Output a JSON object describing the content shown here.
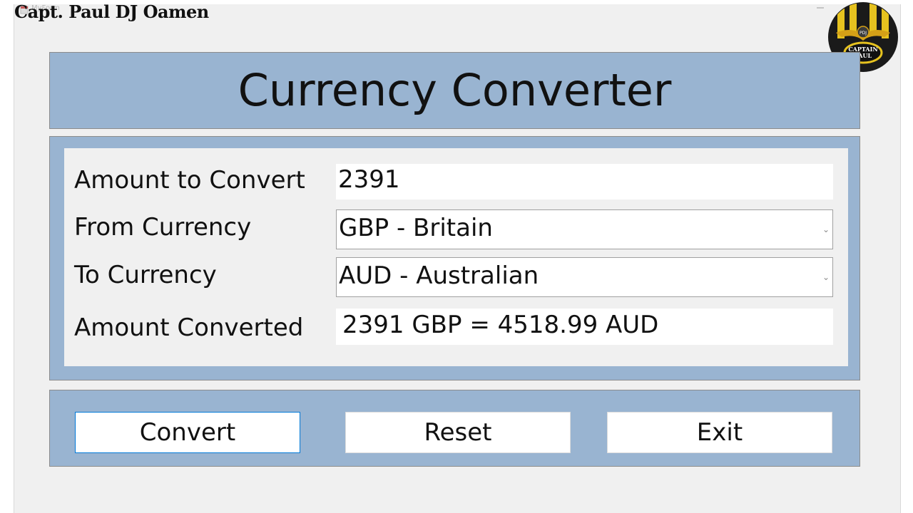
{
  "window": {
    "title": "MyForm",
    "watermark": "Capt. Paul DJ Oamen",
    "logo_text": {
      "top": "PDJ",
      "bottom_line1": "CAPTAIN",
      "bottom_line2": "PAUL"
    }
  },
  "header": {
    "title": "Currency Converter"
  },
  "form": {
    "amount_label": "Amount to Convert",
    "amount_value": "2391",
    "from_label": "From Currency",
    "from_value": "GBP - Britain",
    "to_label": "To Currency",
    "to_value": "AUD - Australian",
    "converted_label": "Amount Converted",
    "converted_value": "2391 GBP = 4518.99 AUD"
  },
  "buttons": {
    "convert": "Convert",
    "reset": "Reset",
    "exit": "Exit"
  },
  "colors": {
    "panel": "#99b4d1",
    "form_background": "#f0f0f0",
    "focus_border": "#0078d7"
  }
}
